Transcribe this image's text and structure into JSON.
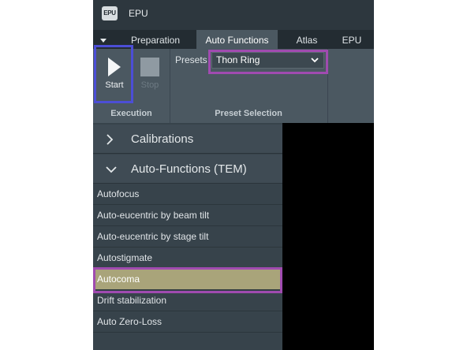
{
  "app": {
    "title": "EPU",
    "logo_text": "EPU"
  },
  "tabs": [
    {
      "label": "Preparation",
      "active": false
    },
    {
      "label": "Auto Functions",
      "active": true
    },
    {
      "label": "Atlas",
      "active": false
    },
    {
      "label": "EPU",
      "active": false
    }
  ],
  "ribbon": {
    "start_label": "Start",
    "stop_label": "Stop",
    "execution_group": "Execution",
    "presets_label": "Presets",
    "presets_value": "Thon Ring",
    "preset_group": "Preset Selection"
  },
  "sidebar": {
    "sections": [
      {
        "label": "Calibrations",
        "expanded": false
      },
      {
        "label": "Auto-Functions (TEM)",
        "expanded": true
      }
    ],
    "items": [
      {
        "label": "Autofocus",
        "selected": false
      },
      {
        "label": "Auto-eucentric by beam tilt",
        "selected": false
      },
      {
        "label": "Auto-eucentric by stage tilt",
        "selected": false
      },
      {
        "label": "Autostigmate",
        "selected": false
      },
      {
        "label": "Autocoma",
        "selected": true
      },
      {
        "label": "Drift stabilization",
        "selected": false
      },
      {
        "label": "Auto Zero-Loss",
        "selected": false
      }
    ]
  },
  "colors": {
    "highlight_blue": "#4c4ed6",
    "highlight_purple": "#a04bb0",
    "selected_item": "#a9a47a"
  }
}
